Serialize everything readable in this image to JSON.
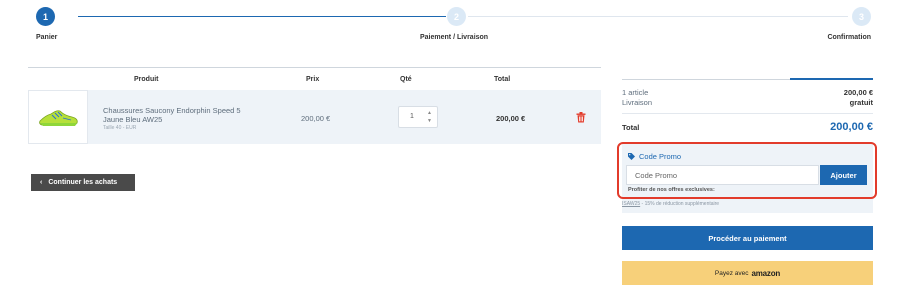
{
  "stepper": {
    "steps": [
      {
        "number": "1",
        "label": "Panier"
      },
      {
        "number": "2",
        "label": "Paiement / Livraison"
      },
      {
        "number": "3",
        "label": "Confirmation"
      }
    ],
    "colors": {
      "active": "#1d68b1",
      "inactive": "#dbe9f6"
    }
  },
  "cart": {
    "headers": {
      "product": "Produit",
      "price": "Prix",
      "qty": "Qté",
      "total": "Total"
    },
    "items": [
      {
        "name": "Chaussures Saucony Endorphin Speed 5 Jaune Bleu AW25",
        "subtitle": "Taille 40 - EUR",
        "price": "200,00 €",
        "qty": "1",
        "total": "200,00 €",
        "image_icon": "running-shoe-icon",
        "remove_icon": "trash-icon"
      }
    ],
    "continue_label": "Continuer les achats",
    "continue_icon": "chevron-left-icon"
  },
  "summary": {
    "articles_label": "1 article",
    "articles_value": "200,00 €",
    "delivery_label": "Livraison",
    "delivery_value": "gratuit",
    "total_label": "Total",
    "total_value": "200,00 €"
  },
  "promo": {
    "title": "Code Promo",
    "input_placeholder": "Code Promo",
    "button_label": "Ajouter",
    "hint": "Profiter de nos offres exclusives:",
    "offer_code": "ISAW25",
    "offer_text": " - 15% de réduction supplémentaire",
    "highlight_color": "#e23b2b"
  },
  "actions": {
    "pay_label": "Procéder au paiement",
    "amazon_prefix": "Payez avec",
    "amazon_word": "amazon"
  }
}
